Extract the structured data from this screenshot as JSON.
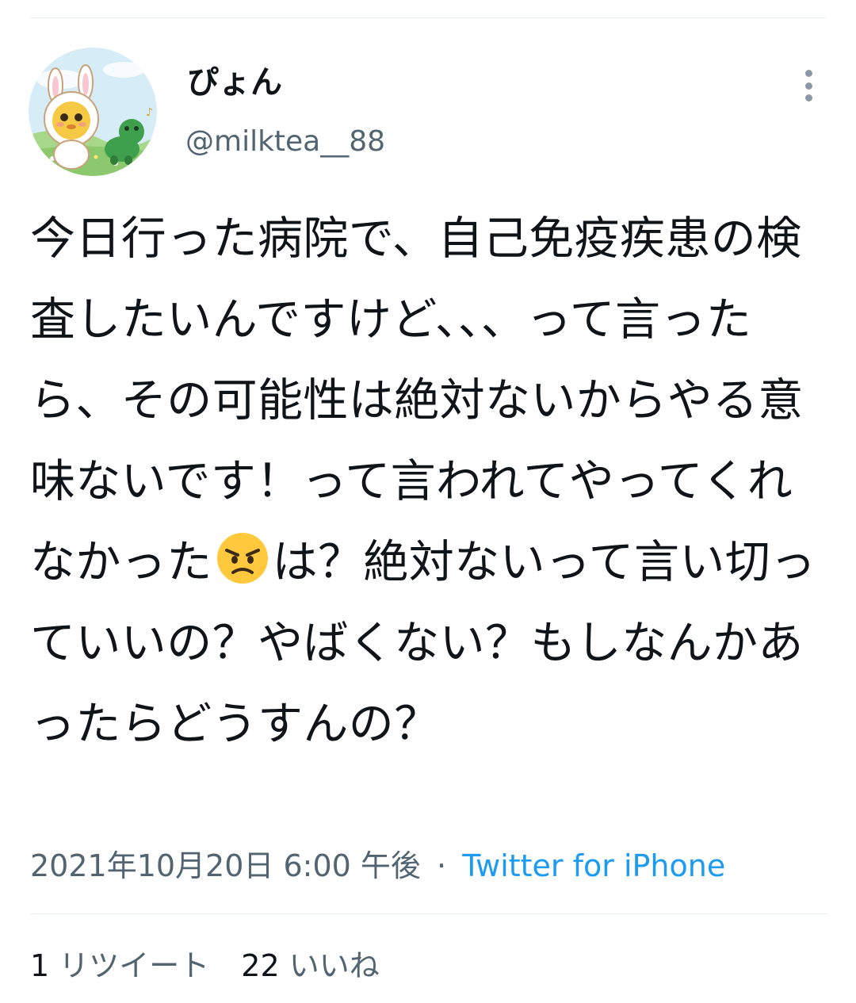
{
  "user": {
    "display_name": "ぴょん",
    "handle": "@milktea__88"
  },
  "tweet": {
    "text_part1": "今日行った病院で、自己免疫疾患の検査したいんですけど、、、って言ったら、その可能性は絶対ないからやる意味ないです！って言われてやってくれなかった",
    "emoji": "angry-face",
    "text_part2": "は？絶対ないって言い切っていいの？やばくない？もしなんかあったらどうすんの？",
    "timestamp": "2021年10月20日 6:00 午後",
    "separator": "·",
    "source": "Twitter for iPhone"
  },
  "stats": {
    "retweets_count": "1",
    "retweets_label": "リツイート",
    "likes_count": "22",
    "likes_label": "いいね"
  },
  "colors": {
    "text_primary": "#0f1419",
    "text_secondary": "#536471",
    "link": "#1d9bf0",
    "divider": "#e6ecf0"
  }
}
